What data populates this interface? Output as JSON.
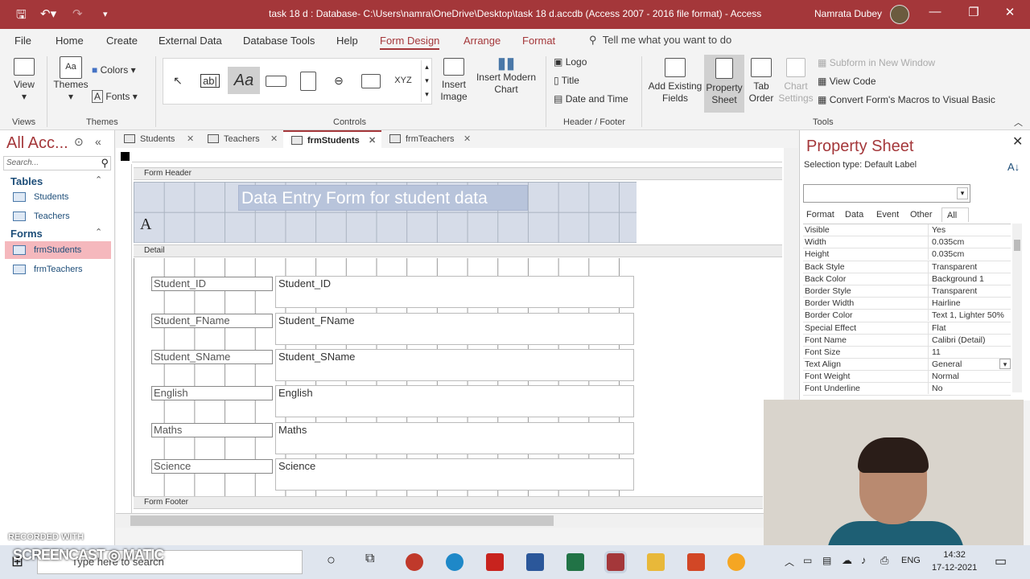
{
  "window": {
    "title": "task 18 d : Database- C:\\Users\\namra\\OneDrive\\Desktop\\task 18 d.accdb (Access 2007 - 2016 file format)  -  Access",
    "user": "Namrata Dubey"
  },
  "menu": {
    "items": [
      "File",
      "Home",
      "Create",
      "External Data",
      "Database Tools",
      "Help",
      "Form Design",
      "Arrange",
      "Format"
    ],
    "tell": "Tell me what you want to do"
  },
  "ribbon": {
    "views_label": "View",
    "views_group": "Views",
    "themes_label": "Themes",
    "colors_label": "Colors",
    "fonts_label": "Fonts",
    "themes_group": "Themes",
    "controls_group": "Controls",
    "insert_image": "Insert Image",
    "insert_chart": "Insert Modern Chart",
    "logo": "Logo",
    "title_btn": "Title",
    "date_time": "Date and Time",
    "header_footer_group": "Header / Footer",
    "add_existing": "Add Existing Fields",
    "property_sheet": "Property Sheet",
    "tab_order": "Tab Order",
    "chart_settings": "Chart Settings",
    "subform": "Subform in New Window",
    "view_code": "View Code",
    "convert_macros": "Convert Form's Macros to Visual Basic",
    "tools_group": "Tools"
  },
  "nav": {
    "title": "All Acc...",
    "search_placeholder": "Search...",
    "tables_label": "Tables",
    "tables": [
      "Students",
      "Teachers"
    ],
    "forms_label": "Forms",
    "forms": [
      "frmStudents",
      "frmTeachers"
    ]
  },
  "tabs": [
    "Students",
    "Teachers",
    "frmStudents",
    "frmTeachers"
  ],
  "form": {
    "header_label": "Form Header",
    "title": "Data Entry Form for student data",
    "detail_label": "Detail",
    "footer_label": "Form Footer",
    "fields": [
      {
        "label": "Student_ID",
        "control": "Student_ID"
      },
      {
        "label": "Student_FName",
        "control": "Student_FName"
      },
      {
        "label": "Student_SName",
        "control": "Student_SName"
      },
      {
        "label": "English",
        "control": "English"
      },
      {
        "label": "Maths",
        "control": "Maths"
      },
      {
        "label": "Science",
        "control": "Science"
      }
    ]
  },
  "property_sheet": {
    "title": "Property Sheet",
    "selection_type": "Selection type:  Default Label",
    "tabs": [
      "Format",
      "Data",
      "Event",
      "Other",
      "All"
    ],
    "rows": [
      {
        "k": "Visible",
        "v": "Yes"
      },
      {
        "k": "Width",
        "v": "0.035cm"
      },
      {
        "k": "Height",
        "v": "0.035cm"
      },
      {
        "k": "Back Style",
        "v": "Transparent"
      },
      {
        "k": "Back Color",
        "v": "Background 1"
      },
      {
        "k": "Border Style",
        "v": "Transparent"
      },
      {
        "k": "Border Width",
        "v": "Hairline"
      },
      {
        "k": "Border Color",
        "v": "Text 1, Lighter 50%"
      },
      {
        "k": "Special Effect",
        "v": "Flat"
      },
      {
        "k": "Font Name",
        "v": "Calibri (Detail)"
      },
      {
        "k": "Font Size",
        "v": "11"
      },
      {
        "k": "Text Align",
        "v": "General"
      },
      {
        "k": "Font Weight",
        "v": "Normal"
      },
      {
        "k": "Font Underline",
        "v": "No"
      }
    ]
  },
  "taskbar": {
    "search": "Type here to search",
    "time": "14:32",
    "date": "17-12-2021",
    "lang": "ENG"
  },
  "watermark": {
    "line1": "RECORDED WITH",
    "line2": "SCREENCAST",
    "line3": "MATIC"
  },
  "colors": {
    "accent": "#a4373a",
    "nav_selected": "#f5b8bd",
    "header_band": "#d6dce8"
  }
}
